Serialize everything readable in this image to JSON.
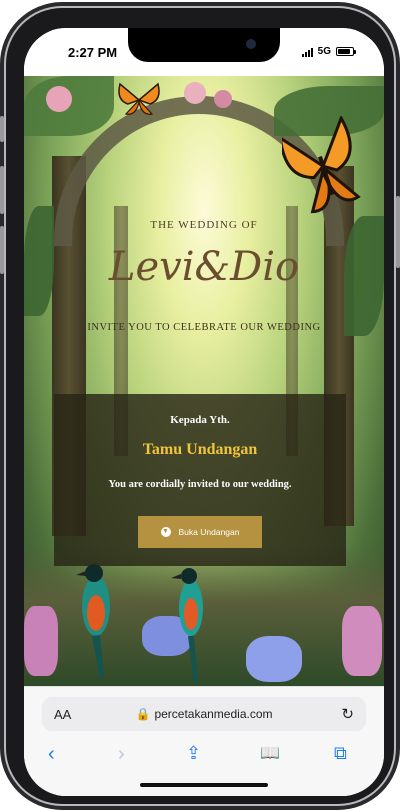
{
  "status": {
    "time": "2:27 PM",
    "network": "5G"
  },
  "invitation": {
    "pre_title": "THE WEDDING OF",
    "couple": "Levi&Dio",
    "invite_line": "INVITE YOU TO CELEBRATE OUR WEDDING",
    "recipient_prefix": "Kepada Yth.",
    "recipient_name": "Tamu Undangan",
    "message": "You are cordially invited to our wedding.",
    "open_button": "Buka Undangan"
  },
  "browser": {
    "aa_label": "AA",
    "url": "percetakanmedia.com",
    "toolbar": {
      "back": "‹",
      "forward": "›",
      "share": "⇪",
      "bookmarks": "📖",
      "tabs": "⧉"
    }
  }
}
